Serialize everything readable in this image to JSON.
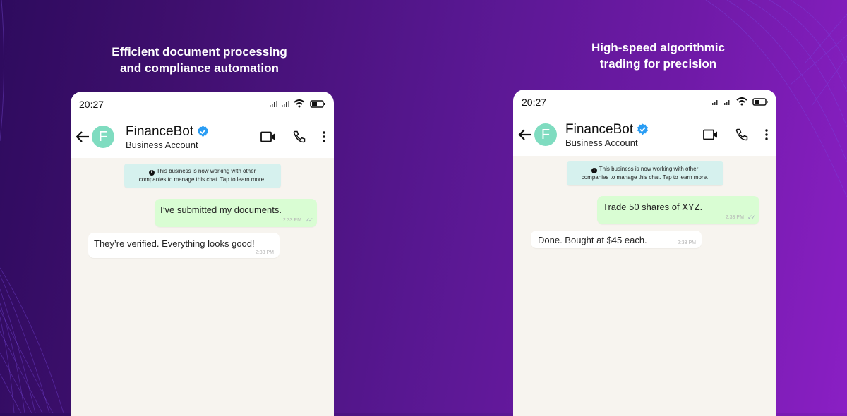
{
  "panels": [
    {
      "caption_line1": "Efficient document processing",
      "caption_line2": "and compliance automation",
      "status": {
        "time": "20:27"
      },
      "header": {
        "avatar_letter": "F",
        "name": "FinanceBot",
        "subtitle": "Business Account"
      },
      "notice": {
        "line1": "This business is now working with other",
        "line2": "companies to manage this chat. Tap to learn more."
      },
      "messages": [
        {
          "direction": "outgoing",
          "text": "I’ve submitted my documents.",
          "time": "2:33 PM"
        },
        {
          "direction": "incoming",
          "text": "They’re verified. Everything looks good!",
          "time": "2:33 PM"
        }
      ]
    },
    {
      "caption_line1": "High-speed algorithmic",
      "caption_line2": "trading for precision",
      "status": {
        "time": "20:27"
      },
      "header": {
        "avatar_letter": "F",
        "name": "FinanceBot",
        "subtitle": "Business Account"
      },
      "notice": {
        "line1": "This business is now working with other",
        "line2": "companies to manage this chat. Tap to learn more."
      },
      "messages": [
        {
          "direction": "outgoing",
          "text": "Trade 50 shares of XYZ.",
          "time": "2:33 PM"
        },
        {
          "direction": "incoming",
          "text": "Done. Bought at $45 each.",
          "time": "2:33 PM"
        }
      ]
    }
  ],
  "colors": {
    "avatar": "#7fdcc0",
    "verified": "#2a9df4",
    "outgoing_bubble": "#d9fdd3",
    "chat_bg": "#f7f4ef",
    "notice_bg": "#d6f1ee"
  }
}
